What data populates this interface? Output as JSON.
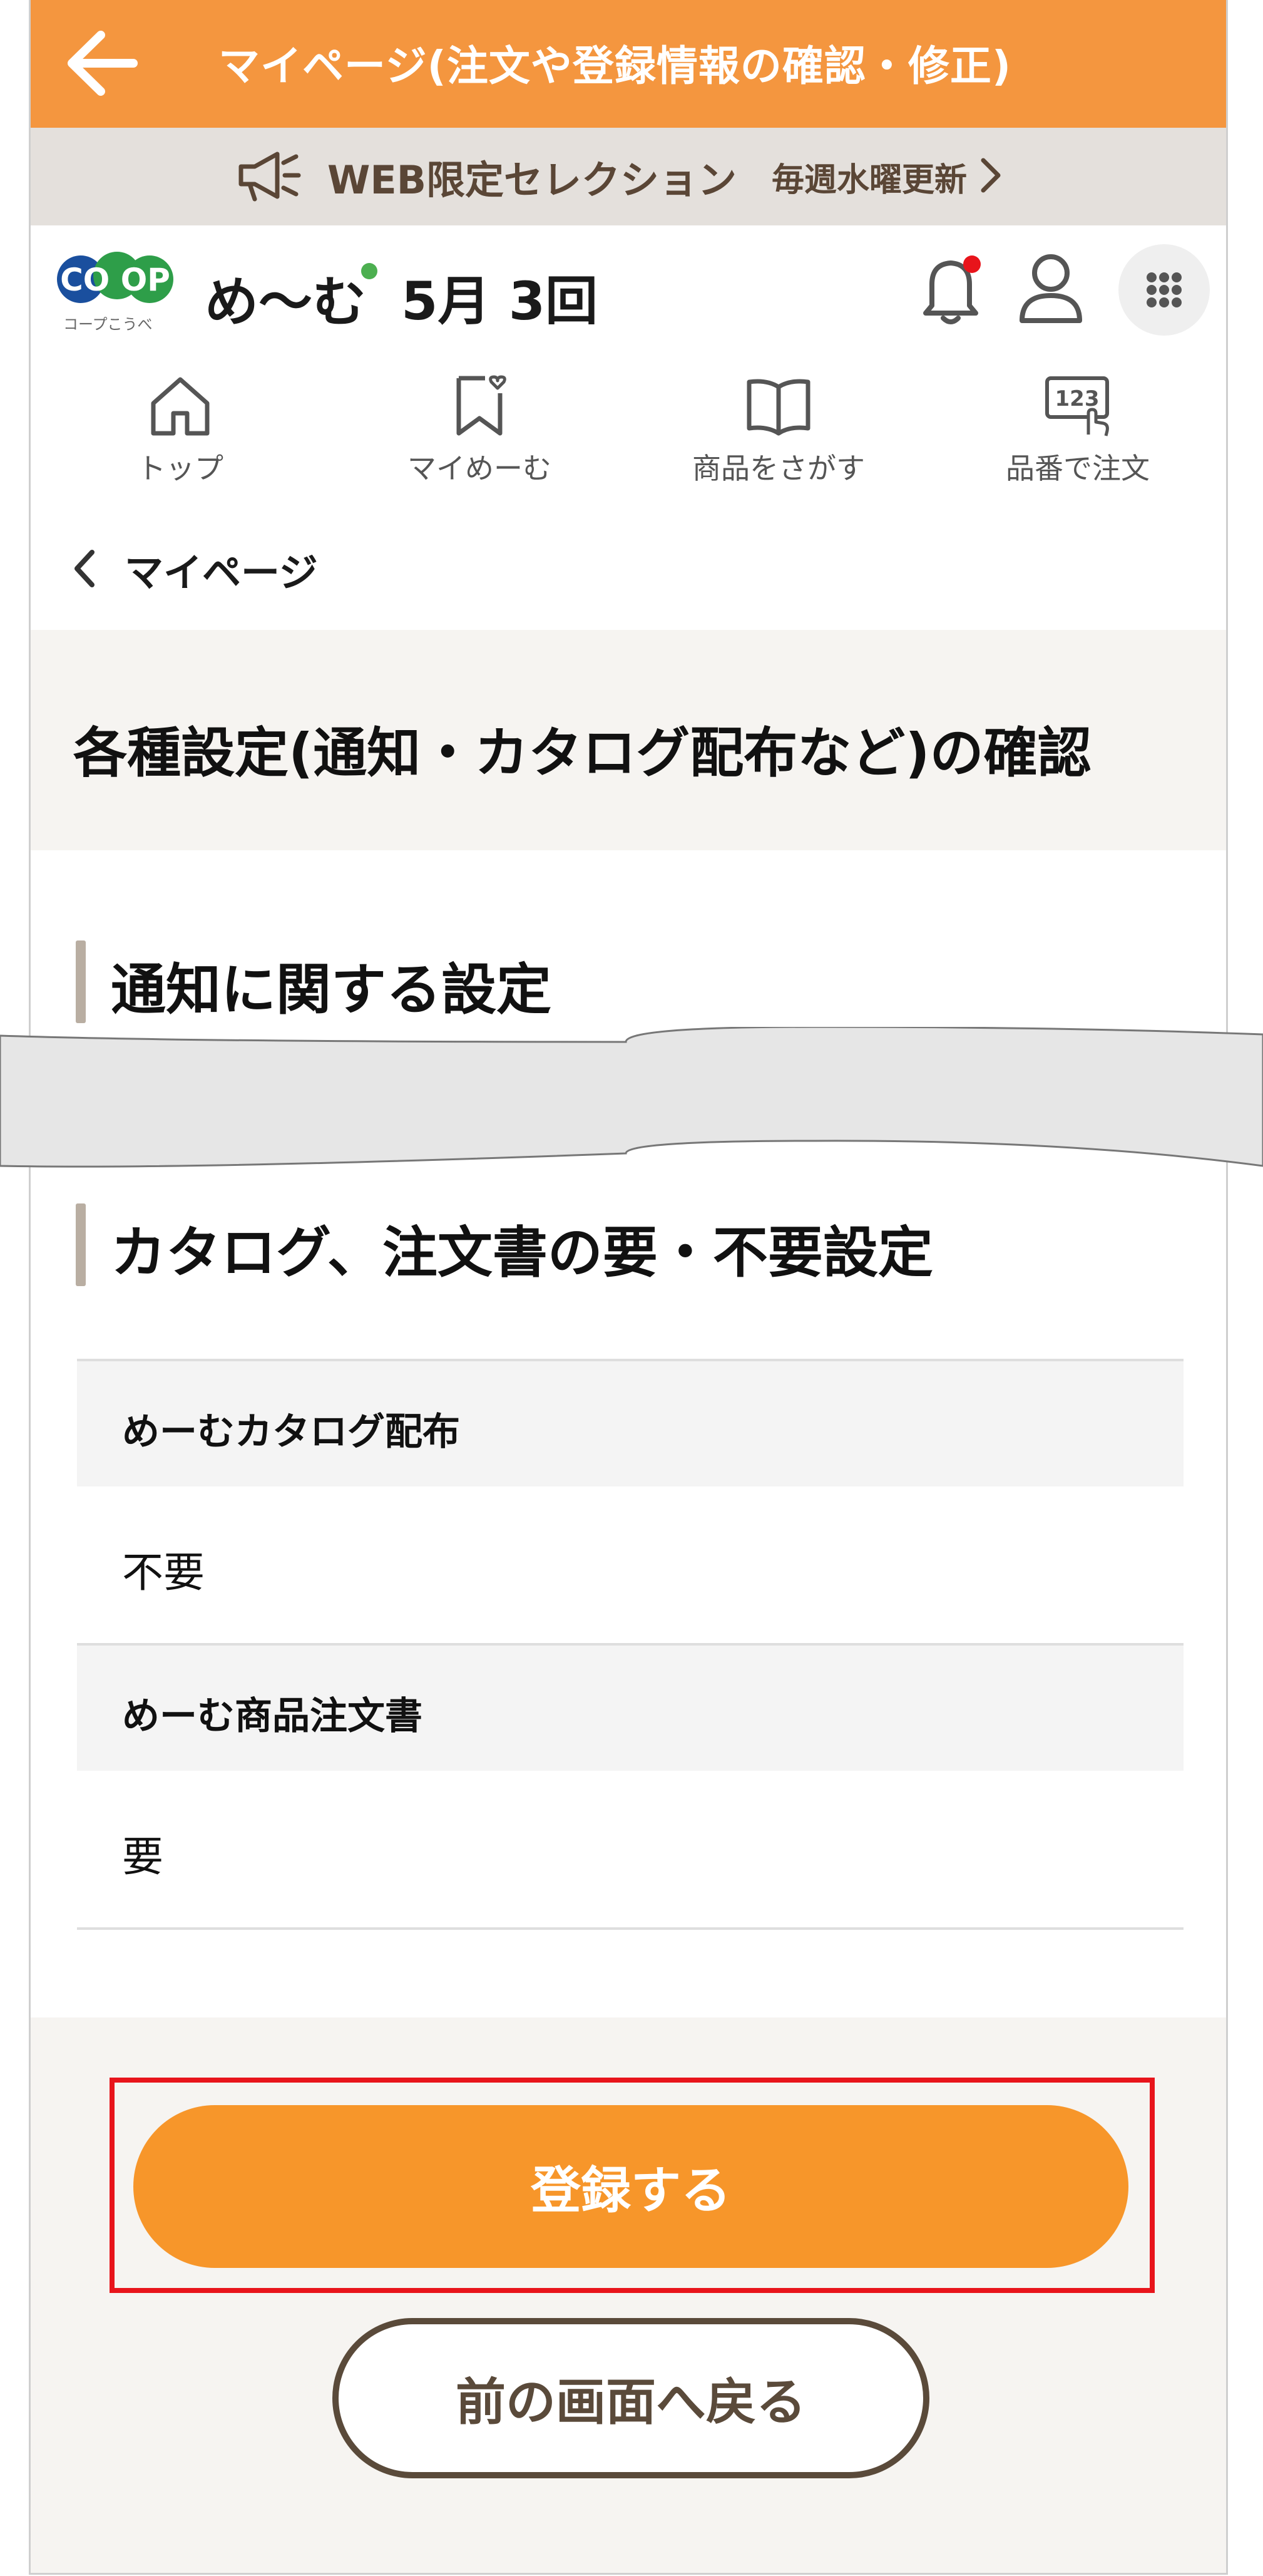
{
  "header": {
    "title": "マイページ(注文や登録情報の確認・修正)",
    "back_icon": "back-arrow-icon"
  },
  "promo": {
    "title": "WEB限定セレクション",
    "subtitle": "毎週水曜更新"
  },
  "brand": {
    "logo_text": "CO OP",
    "logo_subtext": "コープこうべ",
    "name": "め〜む",
    "issue": "5月 3回"
  },
  "nav": {
    "items": [
      {
        "label": "トップ",
        "icon": "home-icon"
      },
      {
        "label": "マイめーむ",
        "icon": "bookmark-heart-icon"
      },
      {
        "label": "商品をさがす",
        "icon": "book-icon"
      },
      {
        "label": "品番で注文",
        "icon": "number-input-icon"
      }
    ]
  },
  "breadcrumb": {
    "label": "マイページ"
  },
  "page": {
    "title": "各種設定(通知・カタログ配布など)の確認"
  },
  "sections": {
    "notification": {
      "title": "通知に関する設定"
    },
    "catalog": {
      "title": "カタログ、注文書の要・不要設定",
      "rows": [
        {
          "label": "めーむカタログ配布",
          "value": "不要"
        },
        {
          "label": "めーむ商品注文書",
          "value": "要"
        }
      ]
    }
  },
  "actions": {
    "register_label": "登録する",
    "back_label": "前の画面へ戻る"
  },
  "colors": {
    "header": "#f4963f",
    "primary_button": "#f7962a",
    "highlight_border": "#e8141b",
    "secondary_border": "#5a4a3a",
    "promo_bg": "#e4e0dc",
    "section_bar": "#b9aea2",
    "notification_dot": "#e8141b"
  }
}
